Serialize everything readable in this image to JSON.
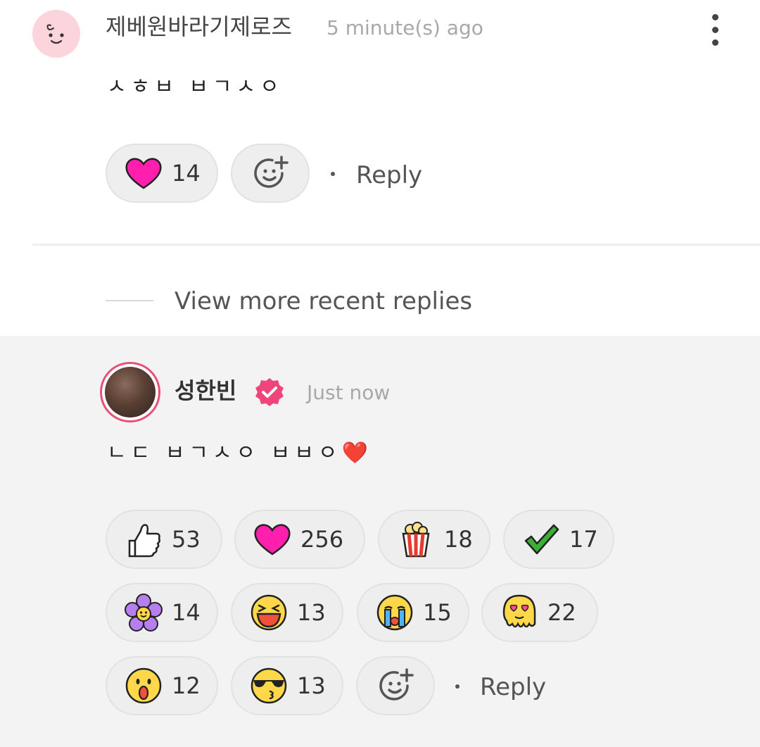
{
  "comment": {
    "username": "제베원바라기제로즈",
    "time": "5 minute(s) ago",
    "text": "ㅅㅎㅂ ㅂㄱㅅㅇ",
    "reactions": [
      {
        "icon": "heart-icon",
        "count": "14",
        "color": "#ff1fae"
      }
    ],
    "reply_label": "Reply"
  },
  "view_more": "View more recent replies",
  "reply": {
    "username": "성한빈",
    "time": "Just now",
    "text": "ㄴㄷ ㅂㄱㅅㅇ ㅂㅂㅇ❤️",
    "reactions": [
      {
        "icon": "thumbs-up-icon",
        "count": "53"
      },
      {
        "icon": "heart-icon",
        "count": "256"
      },
      {
        "icon": "popcorn-icon",
        "count": "18"
      },
      {
        "icon": "checkmark-icon",
        "count": "17"
      },
      {
        "icon": "flower-icon",
        "count": "14"
      },
      {
        "icon": "laughing-face-icon",
        "count": "13"
      },
      {
        "icon": "crying-face-icon",
        "count": "15"
      },
      {
        "icon": "heart-eyes-melting-icon",
        "count": "22"
      },
      {
        "icon": "surprised-face-icon",
        "count": "12"
      },
      {
        "icon": "sunglasses-kiss-face-icon",
        "count": "13"
      }
    ],
    "reply_label": "Reply"
  },
  "colors": {
    "badge": "#f0457a",
    "heart": "#ff1fae",
    "check": "#3cb034",
    "pill_bg": "#eeeeee",
    "reply_bg": "#f3f3f3"
  }
}
